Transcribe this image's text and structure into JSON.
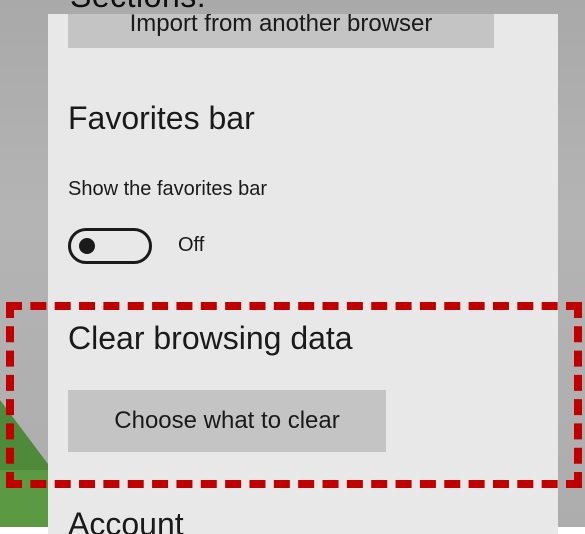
{
  "caption_top": "Sections:",
  "import_button_label": "Import from another browser",
  "favorites_section": {
    "title": "Favorites bar",
    "show_label": "Show the favorites bar",
    "toggle_state": "Off"
  },
  "clear_section": {
    "title": "Clear browsing data",
    "button_label": "Choose what to clear"
  },
  "account_section": {
    "title": "Account"
  },
  "colors": {
    "panel_bg": "#e8e8e8",
    "button_bg": "#c4c4c4",
    "highlight": "#c00000"
  }
}
